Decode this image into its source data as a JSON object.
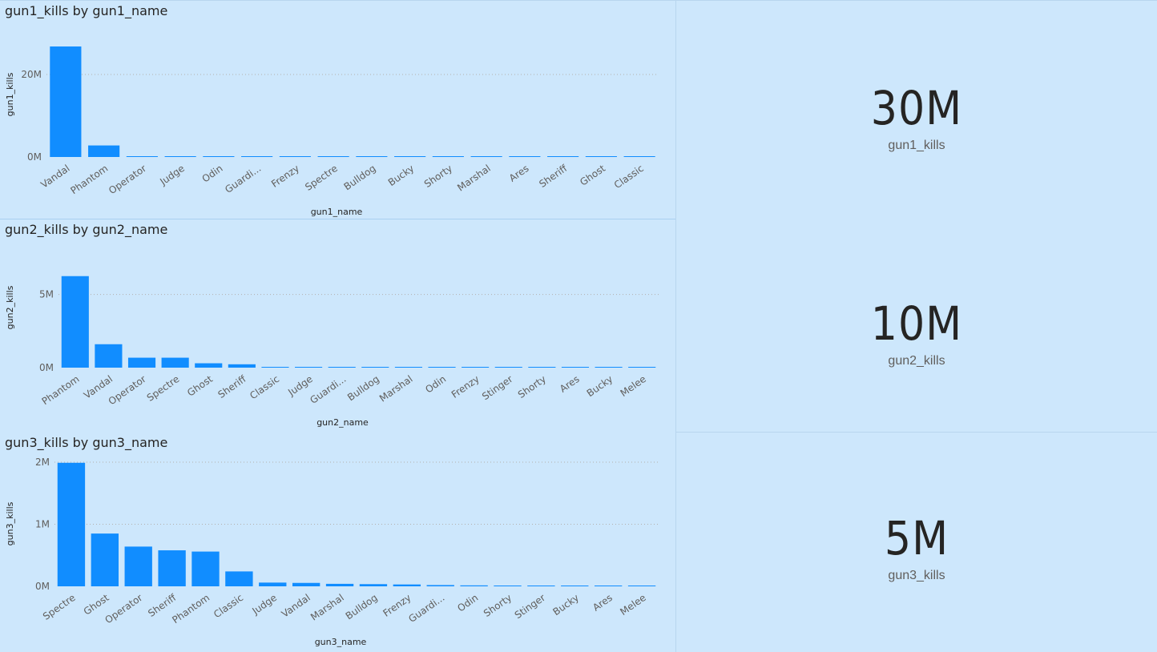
{
  "colors": {
    "background": "#cde7fc",
    "bar": "#118dff",
    "gridline": "#b3b0ad",
    "text": "#252423",
    "subtext": "#605e5c"
  },
  "chart_data": [
    {
      "type": "bar",
      "title": "gun1_kills by gun1_name",
      "xlabel": "gun1_name",
      "ylabel": "gun1_kills",
      "yticks": [
        "0M",
        "20M"
      ],
      "ylim": [
        0,
        27000000
      ],
      "grid": true,
      "categories": [
        "Vandal",
        "Phantom",
        "Operator",
        "Judge",
        "Odin",
        "Guardi...",
        "Frenzy",
        "Spectre",
        "Bulldog",
        "Bucky",
        "Shorty",
        "Marshal",
        "Ares",
        "Sheriff",
        "Ghost",
        "Classic"
      ],
      "values": [
        26800000,
        2800000,
        60000,
        50000,
        40000,
        35000,
        30000,
        28000,
        25000,
        22000,
        20000,
        18000,
        15000,
        12000,
        10000,
        8000
      ]
    },
    {
      "type": "bar",
      "title": "gun2_kills by gun2_name",
      "xlabel": "gun2_name",
      "ylabel": "gun2_kills",
      "yticks": [
        "0M",
        "5M"
      ],
      "ylim": [
        0,
        6400000
      ],
      "grid": true,
      "categories": [
        "Phantom",
        "Vandal",
        "Operator",
        "Spectre",
        "Ghost",
        "Sheriff",
        "Classic",
        "Judge",
        "Guardi...",
        "Bulldog",
        "Marshal",
        "Odin",
        "Frenzy",
        "Stinger",
        "Shorty",
        "Ares",
        "Bucky",
        "Melee"
      ],
      "values": [
        6250000,
        1600000,
        680000,
        680000,
        300000,
        230000,
        30000,
        25000,
        22000,
        20000,
        18000,
        16000,
        14000,
        12000,
        10000,
        9000,
        8000,
        6000
      ]
    },
    {
      "type": "bar",
      "title": "gun3_kills by gun3_name",
      "xlabel": "gun3_name",
      "ylabel": "gun3_kills",
      "yticks": [
        "0M",
        "1M",
        "2M"
      ],
      "ylim": [
        0,
        2000000
      ],
      "grid": true,
      "categories": [
        "Spectre",
        "Ghost",
        "Operator",
        "Sheriff",
        "Phantom",
        "Classic",
        "Judge",
        "Vandal",
        "Marshal",
        "Bulldog",
        "Frenzy",
        "Guardi...",
        "Odin",
        "Shorty",
        "Stinger",
        "Bucky",
        "Ares",
        "Melee"
      ],
      "values": [
        1990000,
        850000,
        640000,
        580000,
        560000,
        240000,
        60000,
        55000,
        40000,
        35000,
        30000,
        20000,
        15000,
        12000,
        10000,
        9000,
        8000,
        6000
      ]
    }
  ],
  "cards": [
    {
      "value": "30M",
      "label": "gun1_kills"
    },
    {
      "value": "10M",
      "label": "gun2_kills"
    },
    {
      "value": "5M",
      "label": "gun3_kills"
    }
  ]
}
